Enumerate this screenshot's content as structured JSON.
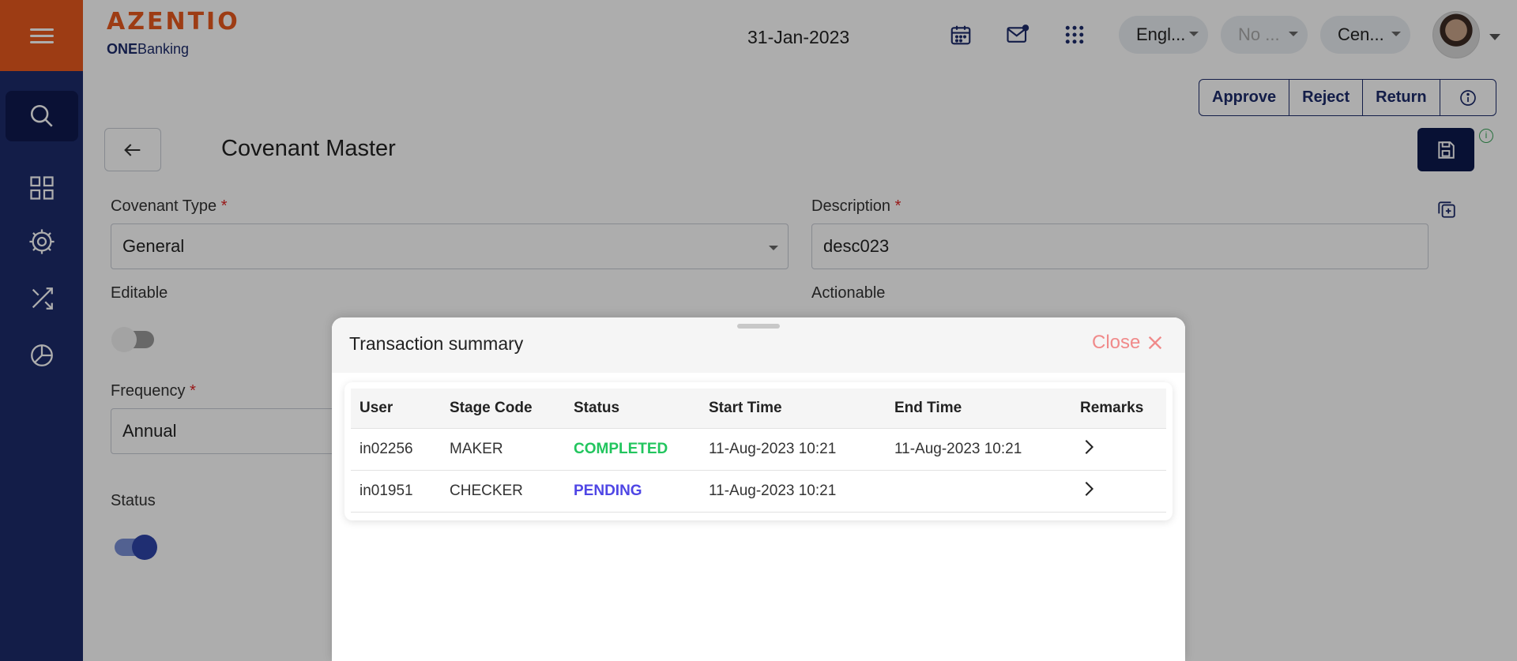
{
  "header": {
    "logo": "AZENTIO",
    "logo_sub_bold": "ONE",
    "logo_sub_rest": "Banking",
    "date": "31-Jan-2023",
    "language": "Engl...",
    "entity": "No ...",
    "branch": "Cen..."
  },
  "actions": {
    "approve": "Approve",
    "reject": "Reject",
    "return": "Return"
  },
  "page": {
    "title": "Covenant Master",
    "covenant_type_label": "Covenant Type",
    "covenant_type_value": "General",
    "description_label": "Description",
    "description_value": "desc023",
    "editable_label": "Editable",
    "actionable_label": "Actionable",
    "frequency_label": "Frequency",
    "frequency_value": "Annual",
    "status_label": "Status",
    "required_mark": "*"
  },
  "toggles": {
    "editable_on": false,
    "status_on": true
  },
  "modal": {
    "title": "Transaction summary",
    "close_label": "Close",
    "columns": [
      "User",
      "Stage Code",
      "Status",
      "Start Time",
      "End Time",
      "Remarks"
    ],
    "rows": [
      {
        "user": "in02256",
        "stage": "MAKER",
        "status": "COMPLETED",
        "start": "11-Aug-2023 10:21",
        "end": "11-Aug-2023 10:21"
      },
      {
        "user": "in01951",
        "stage": "CHECKER",
        "status": "PENDING",
        "start": "11-Aug-2023 10:21",
        "end": ""
      }
    ]
  },
  "colors": {
    "brand_orange": "#e8591e",
    "sidebar_navy": "#1d2b6b",
    "completed_green": "#22c55e",
    "pending_indigo": "#4f46e5",
    "close_red": "#f08a8a"
  }
}
